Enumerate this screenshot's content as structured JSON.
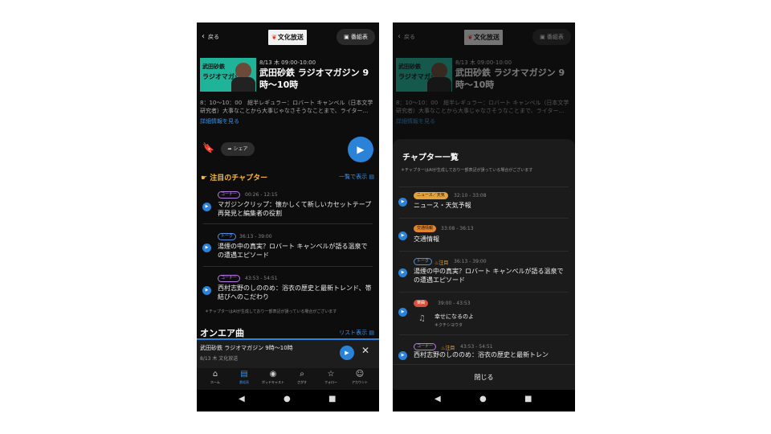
{
  "common": {
    "back_label": "戻る",
    "station_logo": "文化放送",
    "schedule_label": "番組表",
    "thumb_line1": "武田砂鉄",
    "thumb_line2": "ラジオマガジン",
    "airtime": "8/13 木 09:00-10:00",
    "program_title": "武田砂鉄 ラジオマガジン 9時〜10時",
    "description": "8：10〜10：00　総半レギュラー：ロバート キャンベル（日本文学研究者）大事なことから大事じゃなさそうなことまで、ライター…",
    "more_details": "詳細情報を見る"
  },
  "left": {
    "share_label": "シェア",
    "chapters_heading": "注目のチャプター",
    "show_all_label": "一覧で表示",
    "chapters": [
      {
        "tag": "コーナー",
        "time": "00:26 - 12:15",
        "title": "マガジンクリップ：懐かしくて新しいカセットテープ再発見と編集者の役割"
      },
      {
        "tag": "トーク",
        "time": "36:13 - 39:00",
        "title": "湯煙の中の真実？ロバート キャンベルが語る温泉での遭遇エピソード"
      },
      {
        "tag": "コーナー",
        "time": "43:53 - 54:51",
        "title": "西村志野のしののめ：浴衣の歴史と最新トレンド、帯結びへのこだわり"
      }
    ],
    "ai_note": "＊チャプターはAIが生成しており一部表記が誤っている場合がございます",
    "onair_heading": "オンエア曲",
    "list_link": "リスト表示",
    "mini_title": "武田砂鉄 ラジオマガジン 9時〜10時",
    "mini_sub": "8/13 木 文化放送",
    "tabs": [
      {
        "icon": "⌂",
        "label": "ホーム"
      },
      {
        "icon": "▤",
        "label": "番組表"
      },
      {
        "icon": "◉",
        "label": "ポッドキャスト"
      },
      {
        "icon": "⌕",
        "label": "さがす"
      },
      {
        "icon": "☆",
        "label": "フォロー"
      },
      {
        "icon": "☺",
        "label": "アカウント"
      }
    ]
  },
  "right": {
    "sheet_title": "チャプター一覧",
    "ai_note": "＊チャプターはAIが生成しており一部表記が誤っている場合がございます",
    "chapters": [
      {
        "tag": "ニュース／天気",
        "time": "32:10 - 33:08",
        "title": "ニュース・天気予報"
      },
      {
        "tag": "交通情報",
        "time": "33:08 - 36:13",
        "title": "交通情報"
      },
      {
        "tag": "トーク",
        "badge": "注目",
        "time": "36:13 - 39:00",
        "title": "湯煙の中の真実？ロバート キャンベルが語る温泉での遭遇エピソード"
      },
      {
        "tag": "楽曲",
        "time": "39:00 - 43:53",
        "song_title": "幸せになるのよ",
        "song_artist": "キクチシヨウタ"
      },
      {
        "tag": "コーナー",
        "badge": "注目",
        "time": "43:53 - 54:51",
        "title": "西村志野のしののめ：浴衣の歴史と最新トレン"
      }
    ],
    "close_label": "閉じる"
  },
  "sysnav": {
    "back": "◀",
    "home": "●",
    "recents": "■"
  }
}
